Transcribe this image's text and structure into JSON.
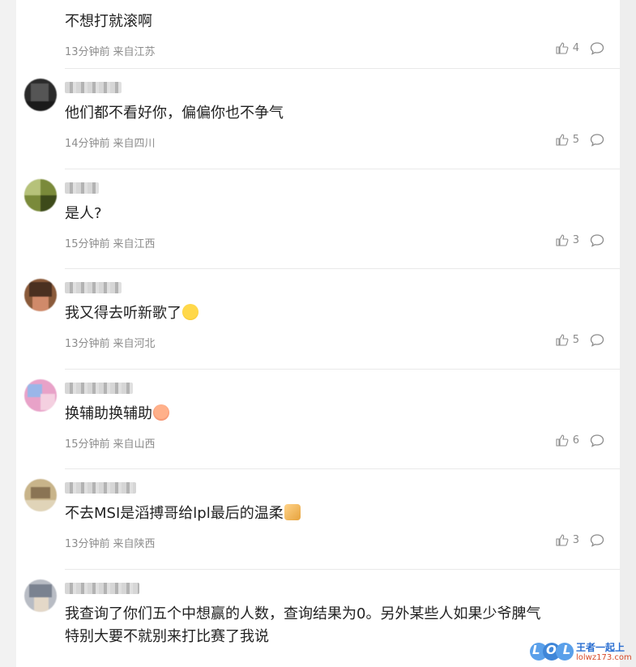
{
  "comments": [
    {
      "text": "不想打就滚啊",
      "time": "13分钟前",
      "location": "来自江苏",
      "likes": "4"
    },
    {
      "text": "他们都不看好你，偏偏你也不争气",
      "time": "14分钟前",
      "location": "来自四川",
      "likes": "5"
    },
    {
      "text": "是人?",
      "time": "15分钟前",
      "location": "来自江西",
      "likes": "3"
    },
    {
      "text": "我又得去听新歌了",
      "time": "13分钟前",
      "location": "来自河北",
      "likes": "5",
      "emoji": "laugh-cry-emoji"
    },
    {
      "text": "换辅助换辅助",
      "time": "15分钟前",
      "location": "来自山西",
      "likes": "6",
      "emoji": "laughing-emoji"
    },
    {
      "text": "不去MSI是滔搏哥给lpl最后的温柔",
      "time": "13分钟前",
      "location": "来自陕西",
      "likes": "3",
      "emoji": "thumbs-up-emoji"
    },
    {
      "text_line1": "我查询了你们五个中想赢的人数，查询结果为0。另外某些人如果少爷脾气",
      "text_line2": "特别大要不就别来打比赛了我说"
    }
  ],
  "watermark": {
    "logo": "LOL",
    "brand": "王者一起上",
    "site": "lolwz173.com"
  },
  "colors": {
    "text": "#222222",
    "meta": "#8c8c8c",
    "divider": "#e9e9e9",
    "background": "#f2f2f2"
  }
}
